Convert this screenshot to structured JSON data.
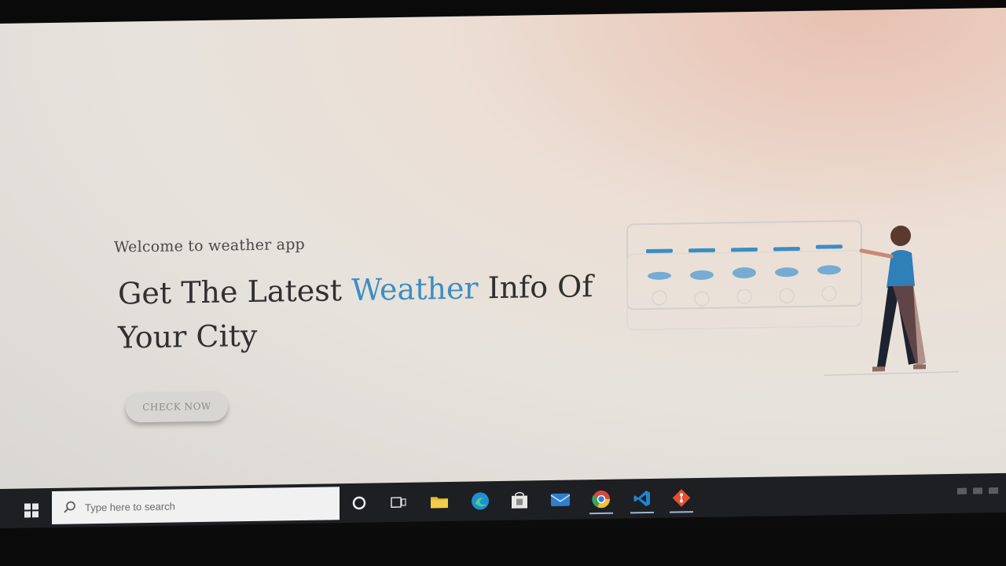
{
  "hero": {
    "subtitle": "Welcome to weather app",
    "title_part1": "Get The Latest ",
    "title_accent": "Weather",
    "title_part2": " Info Of Your City",
    "button_label": "CHECK NOW"
  },
  "taskbar": {
    "search_placeholder": "Type here to search",
    "icons": [
      "cortana-icon",
      "task-view-icon",
      "file-explorer-icon",
      "edge-icon",
      "store-icon",
      "mail-icon",
      "chrome-icon",
      "vscode-icon",
      "git-icon"
    ]
  },
  "colors": {
    "accent": "#3b8ec2",
    "title_text": "#303030",
    "taskbar": "#1d1f22"
  }
}
